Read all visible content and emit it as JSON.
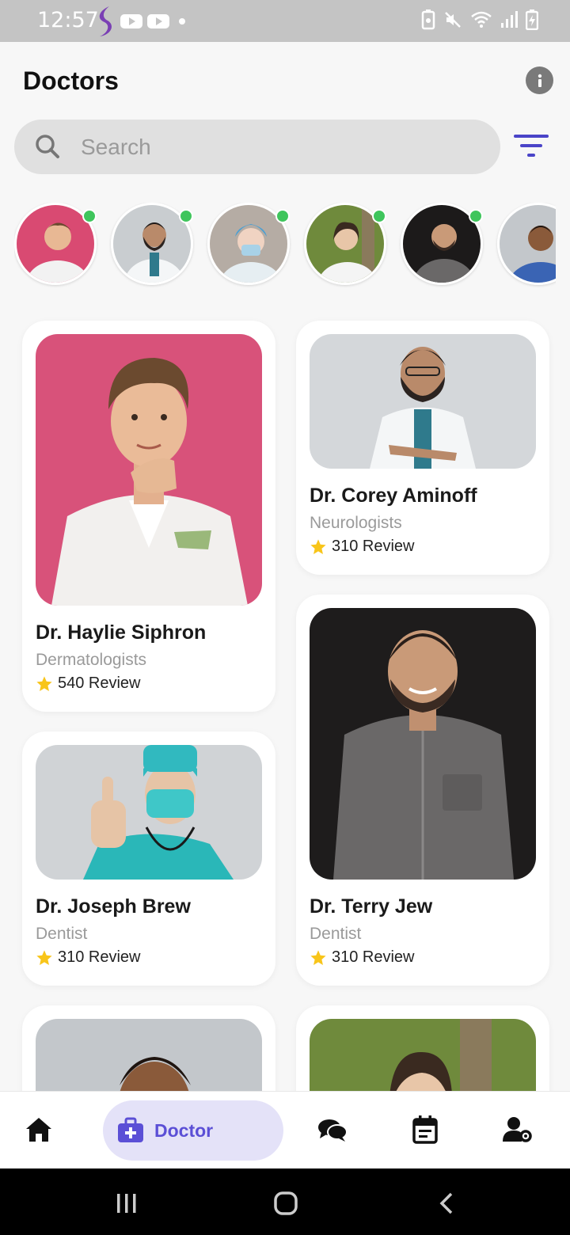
{
  "status_bar": {
    "time": "12:57"
  },
  "header": {
    "title": "Doctors"
  },
  "search": {
    "placeholder": "Search"
  },
  "colors": {
    "accent": "#5b4fd6",
    "online": "#3fc55c",
    "star": "#f8c51a"
  },
  "stories": [
    {
      "name": "story-avatar-1",
      "online": true
    },
    {
      "name": "story-avatar-2",
      "online": true
    },
    {
      "name": "story-avatar-3",
      "online": true
    },
    {
      "name": "story-avatar-4",
      "online": true
    },
    {
      "name": "story-avatar-5",
      "online": true
    },
    {
      "name": "story-avatar-6",
      "online": false
    }
  ],
  "doctors": [
    {
      "name": "Dr. Haylie Siphron",
      "specialty": "Dermatologists",
      "reviews": "540 Review"
    },
    {
      "name": "Dr. Corey Aminoff",
      "specialty": "Neurologists",
      "reviews": "310 Review"
    },
    {
      "name": "Dr. Joseph Brew",
      "specialty": "Dentist",
      "reviews": "310 Review"
    },
    {
      "name": "Dr. Terry Jew",
      "specialty": "Dentist",
      "reviews": "310 Review"
    }
  ],
  "bottom_nav": {
    "items": [
      {
        "icon": "home-icon"
      },
      {
        "icon": "doctor-bag-icon",
        "label": "Doctor",
        "active": true
      },
      {
        "icon": "chat-icon"
      },
      {
        "icon": "calendar-icon"
      },
      {
        "icon": "user-settings-icon"
      }
    ]
  }
}
